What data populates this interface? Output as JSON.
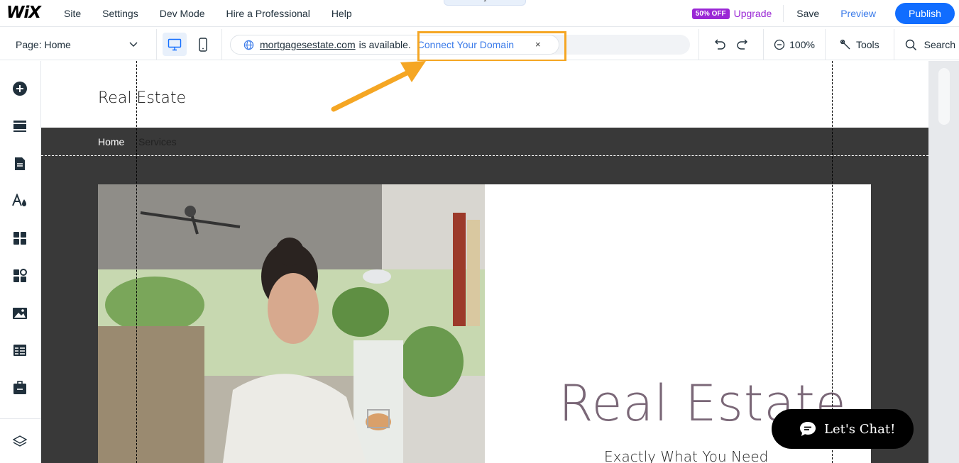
{
  "topbar": {
    "logo": "WiX",
    "menu": [
      "Site",
      "Settings",
      "Dev Mode",
      "Hire a Professional",
      "Help"
    ],
    "badge": "50% OFF",
    "upgrade": "Upgrade",
    "save": "Save",
    "preview": "Preview",
    "publish": "Publish"
  },
  "toolbar": {
    "page_label": "Page: Home",
    "domain": "mortgagesestate.com",
    "available": "is available.",
    "connect": "Connect Your Domain",
    "close": "×",
    "zoom": "100%",
    "tools": "Tools",
    "search": "Search"
  },
  "site": {
    "title": "Real Estate",
    "nav": [
      "Home",
      "Services"
    ],
    "hero_title": "Real Estate",
    "hero_subtitle": "Exactly What You Need"
  },
  "chat": {
    "label": "Let's Chat!"
  },
  "colors": {
    "accent": "#116dff",
    "upgrade": "#9a27d5",
    "highlight": "#f5a623",
    "hero_title": "#7a6777"
  }
}
